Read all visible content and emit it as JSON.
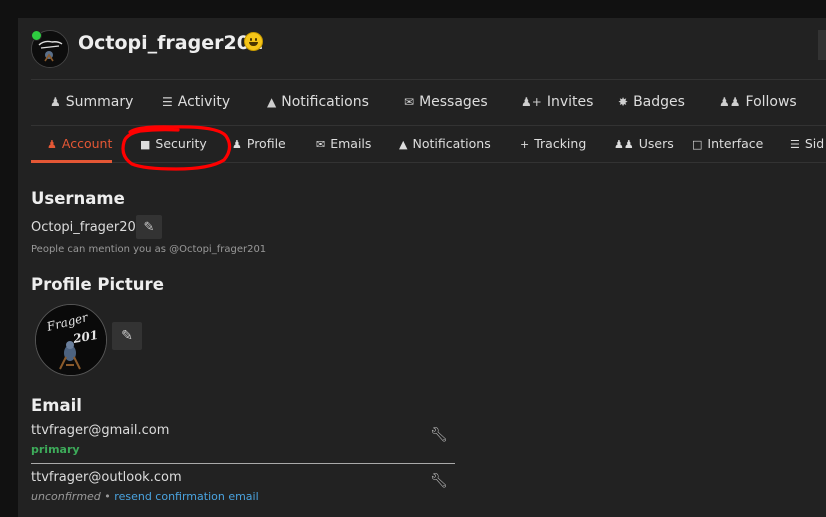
{
  "header": {
    "username": "Octopi_frager201"
  },
  "nav_main": {
    "tabs": [
      {
        "label": "Summary",
        "icon": "user-icon"
      },
      {
        "label": "Activity",
        "icon": "list-icon"
      },
      {
        "label": "Notifications",
        "icon": "bell-icon"
      },
      {
        "label": "Messages",
        "icon": "envelope-icon"
      },
      {
        "label": "Invites",
        "icon": "user-plus-icon"
      },
      {
        "label": "Badges",
        "icon": "certificate-icon"
      },
      {
        "label": "Follows",
        "icon": "users-icon"
      }
    ]
  },
  "nav_sub": {
    "tabs": [
      {
        "label": "Account",
        "icon": "user-icon",
        "active": true
      },
      {
        "label": "Security",
        "icon": "lock-icon"
      },
      {
        "label": "Profile",
        "icon": "user-icon"
      },
      {
        "label": "Emails",
        "icon": "envelope-icon"
      },
      {
        "label": "Notifications",
        "icon": "bell-icon"
      },
      {
        "label": "Tracking",
        "icon": "plus-icon"
      },
      {
        "label": "Users",
        "icon": "users-icon"
      },
      {
        "label": "Interface",
        "icon": "desktop-icon"
      },
      {
        "label": "Sid",
        "icon": "bars-icon"
      }
    ]
  },
  "account": {
    "username_heading": "Username",
    "username_value": "Octopi_frager201",
    "mention_hint": "People can mention you as @Octopi_frager201",
    "profile_picture_heading": "Profile Picture",
    "avatar_text_line1": "Frager",
    "avatar_text_line2": "201",
    "email_heading": "Email",
    "emails": [
      {
        "address": "ttvfrager@gmail.com",
        "status": "primary"
      },
      {
        "address": "ttvfrager@outlook.com",
        "status": "unconfirmed",
        "separator": "•",
        "action": "resend confirmation email"
      }
    ]
  },
  "colors": {
    "accent": "#e45735",
    "primary_green": "#3dab5a",
    "link_blue": "#4aa3df",
    "annotation_red": "#ff0000"
  }
}
